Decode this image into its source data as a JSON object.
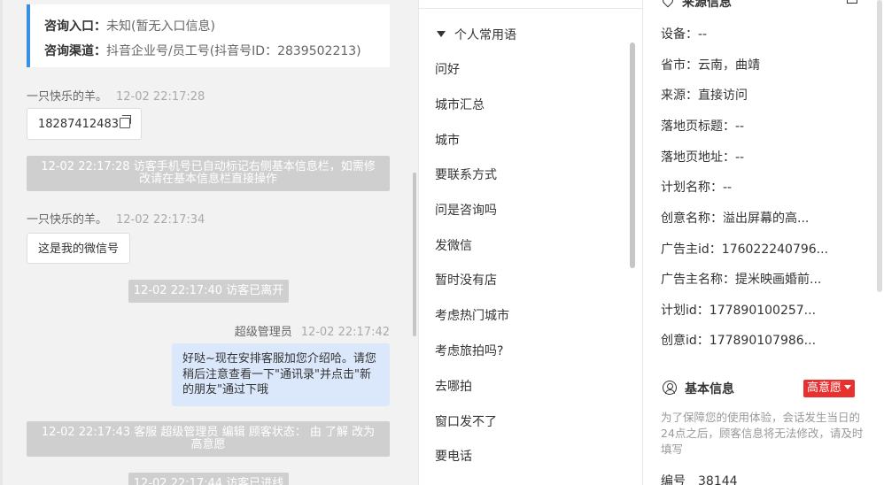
{
  "chat": {
    "info_card": {
      "entry_label": "咨询入口：",
      "entry_value": "未知(暂无入口信息)",
      "channel_label": "咨询渠道：",
      "channel_value": "抖音企业号/员工号(抖音号ID：2839502213)"
    },
    "messages": [
      {
        "sender": "一只快乐的羊。",
        "time": "12-02 22:17:28",
        "text": "18287412483"
      },
      {
        "note": "12-02 22:17:28 访客手机号已自动标记右侧基本信息栏，如需修改请在基本信息栏直接操作"
      },
      {
        "sender": "一只快乐的羊。",
        "time": "12-02 22:17:34",
        "text": "这是我的微信号"
      },
      {
        "note": "12-02 22:17:40 访客已离开"
      },
      {
        "sender": "超级管理员",
        "time": "12-02 22:17:42",
        "text": "好哒~现在安排客服加您介绍哈。请您稍后注意查看一下\"通讯录\"并点击\"新的朋友\"通过下哦"
      },
      {
        "note": "12-02 22:17:43 客服 超级管理员 编辑 顾客状态： 由 了解 改为 高意愿"
      },
      {
        "note": "12-02 22:17:44 访客已进线"
      }
    ]
  },
  "phrases": {
    "group_title": "个人常用语",
    "items": [
      "问好",
      "城市汇总",
      "城市",
      "要联系方式",
      "问是咨询吗",
      "发微信",
      "暂时没有店",
      "考虑热门城市",
      "考虑旅拍吗?",
      "去哪拍",
      "窗口发不了",
      "要电话"
    ]
  },
  "info": {
    "source_title": "来源信息",
    "fields": [
      {
        "label": "设备：",
        "value": "--"
      },
      {
        "label": "省市：",
        "value": "云南，曲靖"
      },
      {
        "label": "来源：",
        "value": "直接访问"
      },
      {
        "label": "落地页标题：",
        "value": "--"
      },
      {
        "label": "落地页地址：",
        "value": "--"
      },
      {
        "label": "计划名称：",
        "value": "--"
      },
      {
        "label": "创意名称：",
        "value": "溢出屏幕的高..."
      },
      {
        "label": "广告主id：",
        "value": "176022240796..."
      },
      {
        "label": "广告主名称：",
        "value": "提米映画婚前..."
      },
      {
        "label": "计划id：",
        "value": "177890100257..."
      },
      {
        "label": "创意id：",
        "value": "177890107986..."
      }
    ],
    "basic": {
      "title": "基本信息",
      "intent": "高意愿",
      "hint": "为了保障您的使用体验，会话发生当日的24点之后，顾客信息将无法修改，请及时填写",
      "id_label": "编号",
      "id_value": "38144"
    }
  }
}
